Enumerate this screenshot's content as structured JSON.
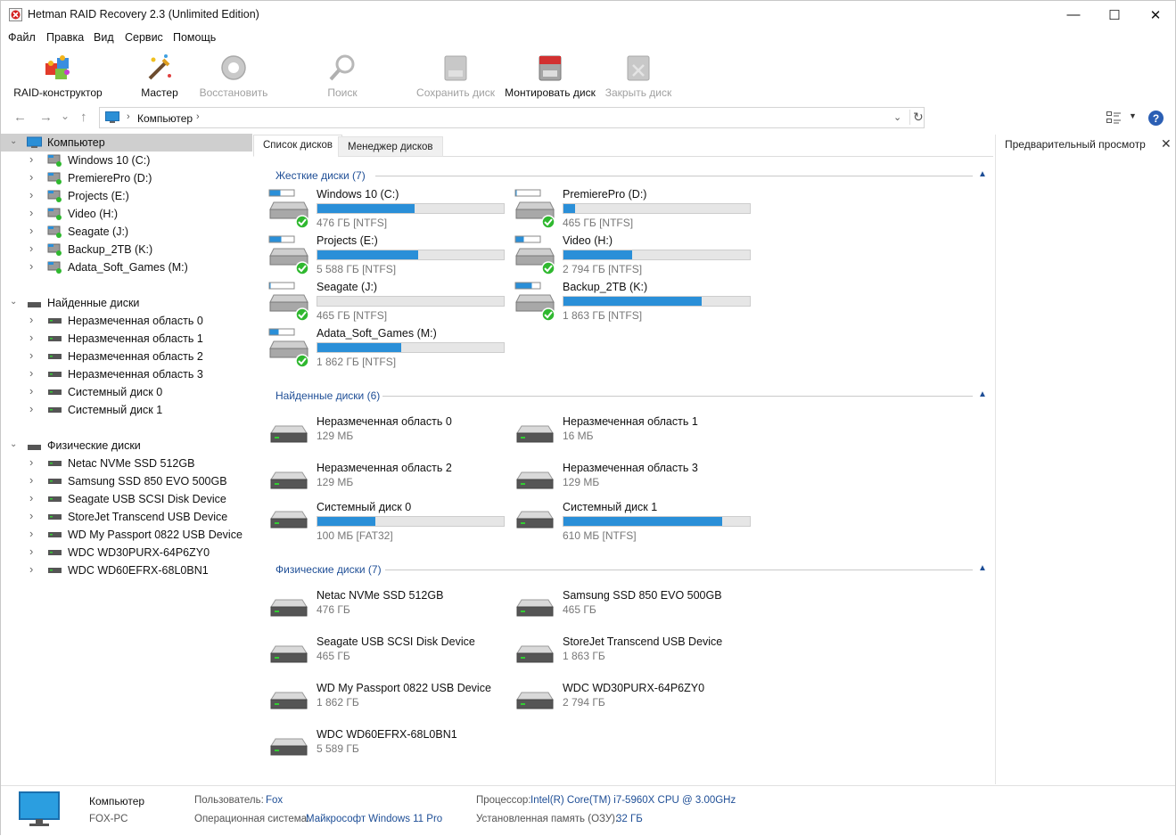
{
  "window": {
    "title": "Hetman RAID Recovery 2.3 (Unlimited Edition)",
    "minimize": "—",
    "maximize": "☐",
    "close": "✕"
  },
  "menu": [
    "Файл",
    "Правка",
    "Вид",
    "Сервис",
    "Помощь"
  ],
  "toolbar": [
    {
      "label": "RAID-конструктор",
      "icon": "puzzle-icon",
      "enabled": true
    },
    {
      "label": "Мастер",
      "icon": "magic-wand-icon",
      "enabled": true
    },
    {
      "label": "Восстановить",
      "icon": "lifebuoy-icon",
      "enabled": false
    },
    {
      "label": "Поиск",
      "icon": "magnifier-icon",
      "enabled": false
    },
    {
      "label": "Сохранить диск",
      "icon": "save-disk-icon",
      "enabled": false
    },
    {
      "label": "Монтировать диск",
      "icon": "mount-disk-icon",
      "enabled": true
    },
    {
      "label": "Закрыть диск",
      "icon": "close-disk-icon",
      "enabled": false
    }
  ],
  "nav": {
    "back": "←",
    "forward": "→",
    "history": "⌄",
    "up": "↑",
    "address": "Компьютер",
    "refresh": "↻",
    "help": "?"
  },
  "tree": {
    "root": "Компьютер",
    "volumes": [
      "Windows 10 (C:)",
      "PremierePro (D:)",
      "Projects (E:)",
      "Video (H:)",
      "Seagate (J:)",
      "Backup_2TB (K:)",
      "Adata_Soft_Games (M:)"
    ],
    "found_label": "Найденные диски",
    "found": [
      "Неразмеченная область 0",
      "Неразмеченная область 1",
      "Неразмеченная область 2",
      "Неразмеченная область 3",
      "Системный диск 0",
      "Системный диск 1"
    ],
    "physical_label": "Физические диски",
    "physical": [
      "Netac NVMe SSD 512GB",
      "Samsung SSD 850 EVO 500GB",
      "Seagate USB SCSI Disk Device",
      "StoreJet Transcend USB Device",
      "WD My Passport 0822 USB Device",
      "WDC WD30PURX-64P6ZY0",
      "WDC WD60EFRX-68L0BN1"
    ]
  },
  "tabs": [
    "Список дисков",
    "Менеджер дисков"
  ],
  "preview": {
    "title": "Предварительный просмотр",
    "close": "✕"
  },
  "sections": {
    "hard": {
      "title": "Жесткие диски (7)",
      "items": [
        {
          "name": "Windows 10 (C:)",
          "size": "476 ГБ [NTFS]",
          "used": 0.52,
          "icon_fill": 0.45
        },
        {
          "name": "PremierePro (D:)",
          "size": "465 ГБ [NTFS]",
          "used": 0.06,
          "icon_fill": 0.05
        },
        {
          "name": "Projects (E:)",
          "size": "5 588 ГБ [NTFS]",
          "used": 0.54,
          "icon_fill": 0.5
        },
        {
          "name": "Video (H:)",
          "size": "2 794 ГБ [NTFS]",
          "used": 0.37,
          "icon_fill": 0.35
        },
        {
          "name": "Seagate (J:)",
          "size": "465 ГБ [NTFS]",
          "used": 0.0,
          "icon_fill": 0.03
        },
        {
          "name": "Backup_2TB (K:)",
          "size": "1 863 ГБ [NTFS]",
          "used": 0.74,
          "icon_fill": 0.7
        },
        {
          "name": "Adata_Soft_Games (M:)",
          "size": "1 862 ГБ [NTFS]",
          "used": 0.45,
          "icon_fill": 0.4
        }
      ]
    },
    "found": {
      "title": "Найденные диски (6)",
      "items": [
        {
          "name": "Неразмеченная область 0",
          "size": "129 МБ"
        },
        {
          "name": "Неразмеченная область 1",
          "size": "16 МБ"
        },
        {
          "name": "Неразмеченная область 2",
          "size": "129 МБ"
        },
        {
          "name": "Неразмеченная область 3",
          "size": "129 МБ"
        },
        {
          "name": "Системный диск 0",
          "size": "100 МБ [FAT32]",
          "used": 0.31
        },
        {
          "name": "Системный диск 1",
          "size": "610 МБ [NTFS]",
          "used": 0.85
        }
      ]
    },
    "physical": {
      "title": "Физические диски (7)",
      "items": [
        {
          "name": "Netac NVMe SSD 512GB",
          "size": "476 ГБ"
        },
        {
          "name": "Samsung SSD 850 EVO 500GB",
          "size": "465 ГБ"
        },
        {
          "name": "Seagate USB SCSI Disk Device",
          "size": "465 ГБ"
        },
        {
          "name": "StoreJet Transcend USB Device",
          "size": "1 863 ГБ"
        },
        {
          "name": "WD My Passport 0822 USB Device",
          "size": "1 862 ГБ"
        },
        {
          "name": "WDC WD30PURX-64P6ZY0",
          "size": "2 794 ГБ"
        },
        {
          "name": "WDC WD60EFRX-68L0BN1",
          "size": "5 589 ГБ"
        }
      ]
    }
  },
  "status": {
    "computer": "Компьютер",
    "host": "FOX-PC",
    "user_key": "Пользователь:",
    "user_val": "Fox",
    "os_key": "Операционная система:",
    "os_val": "Майкрософт Windows 11 Pro",
    "cpu_key": "Процессор:",
    "cpu_val": "Intel(R) Core(TM) i7-5960X CPU @ 3.00GHz",
    "ram_key": "Установленная память (ОЗУ):",
    "ram_val": "32 ГБ"
  },
  "colors": {
    "accent": "#2a8fd8",
    "link": "#1e4e96",
    "ok": "#2fb82f"
  }
}
